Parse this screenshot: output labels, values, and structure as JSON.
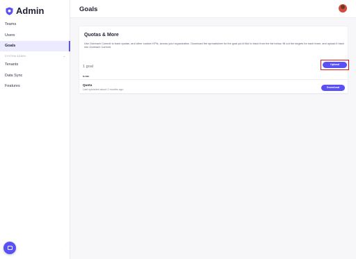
{
  "sidebar": {
    "brand": "Admin",
    "items": [
      {
        "label": "Teams"
      },
      {
        "label": "Users"
      },
      {
        "label": "Goals",
        "active": true
      }
    ],
    "section_label": "SYSTEM ADMIN",
    "section_items": [
      {
        "label": "Tenants"
      },
      {
        "label": "Data Sync"
      },
      {
        "label": "Features"
      }
    ]
  },
  "header": {
    "title": "Goals"
  },
  "card": {
    "title": "Quotas & More",
    "description": "Use Outreach Commit to track quotas, and other custom KPIs, across your organization. Download the spreadsheet for the goal you'd like to track from the list below, fill out the targets for each team, and upload it back into Outreach Commit.",
    "goal_count": "1 goal",
    "upload_label": "Upload",
    "column_name": "NAME",
    "rows": [
      {
        "name": "Quota",
        "subtitle": "Last uploaded about 2 months ago",
        "action_label": "Download"
      }
    ]
  },
  "colors": {
    "accent": "#5951f5",
    "highlight": "#e1121b"
  }
}
